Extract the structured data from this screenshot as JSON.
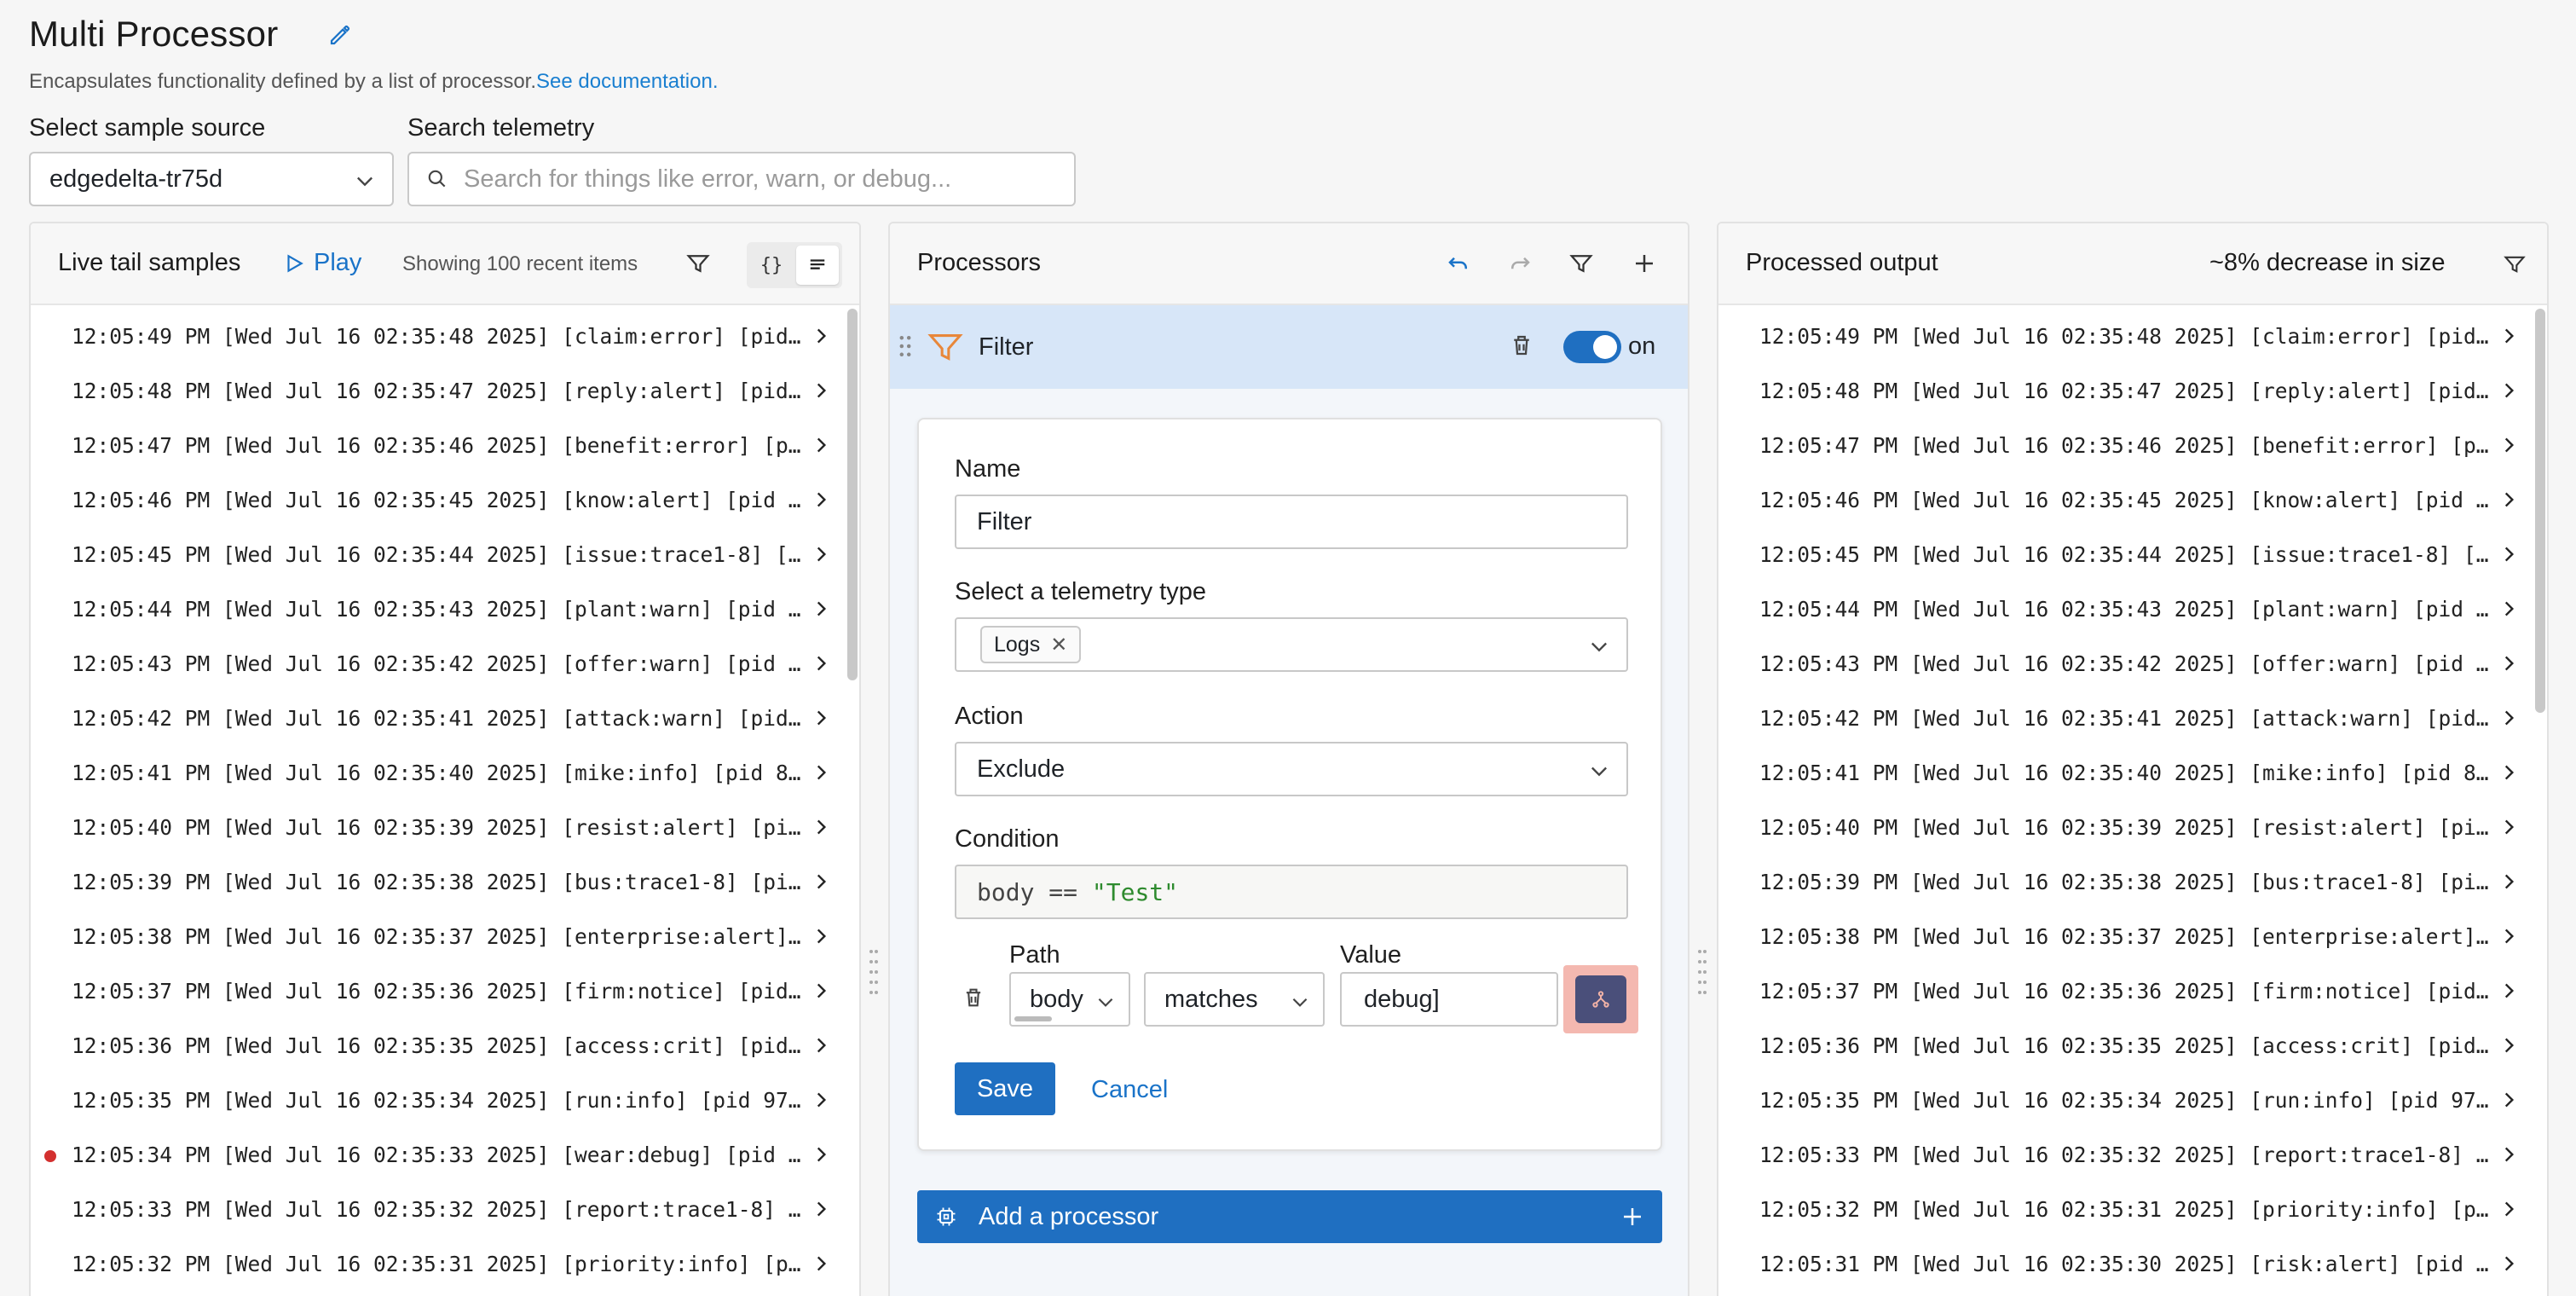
{
  "header": {
    "title": "Multi Processor",
    "subtitle": "Encapsulates functionality defined by a list of processor.",
    "doc_link": "See documentation."
  },
  "controls": {
    "source_label": "Select sample source",
    "source_value": "edgedelta-tr75d",
    "search_label": "Search telemetry",
    "search_placeholder": "Search for things like error, warn, or debug..."
  },
  "live_tail": {
    "title": "Live tail samples",
    "play_label": "Play",
    "showing": "Showing 100 recent items",
    "json_toggle": "{}",
    "rows": [
      "12:05:49 PM [Wed Jul 16 02:35:48 2025] [claim:error] [pid…",
      "12:05:48 PM [Wed Jul 16 02:35:47 2025] [reply:alert] [pid…",
      "12:05:47 PM [Wed Jul 16 02:35:46 2025] [benefit:error] [p…",
      "12:05:46 PM [Wed Jul 16 02:35:45 2025] [know:alert] [pid …",
      "12:05:45 PM [Wed Jul 16 02:35:44 2025] [issue:trace1-8] […",
      "12:05:44 PM [Wed Jul 16 02:35:43 2025] [plant:warn] [pid …",
      "12:05:43 PM [Wed Jul 16 02:35:42 2025] [offer:warn] [pid …",
      "12:05:42 PM [Wed Jul 16 02:35:41 2025] [attack:warn] [pid…",
      "12:05:41 PM [Wed Jul 16 02:35:40 2025] [mike:info] [pid 8…",
      "12:05:40 PM [Wed Jul 16 02:35:39 2025] [resist:alert] [pi…",
      "12:05:39 PM [Wed Jul 16 02:35:38 2025] [bus:trace1-8] [pi…",
      "12:05:38 PM [Wed Jul 16 02:35:37 2025] [enterprise:alert]…",
      "12:05:37 PM [Wed Jul 16 02:35:36 2025] [firm:notice] [pid…",
      "12:05:36 PM [Wed Jul 16 02:35:35 2025] [access:crit] [pid…",
      "12:05:35 PM [Wed Jul 16 02:35:34 2025] [run:info] [pid 97…",
      "12:05:34 PM [Wed Jul 16 02:35:33 2025] [wear:debug] [pid …",
      "12:05:33 PM [Wed Jul 16 02:35:32 2025] [report:trace1-8] …",
      "12:05:32 PM [Wed Jul 16 02:35:31 2025] [priority:info] [p…"
    ],
    "marked_row_index": 15
  },
  "processors": {
    "title": "Processors",
    "filter": {
      "name": "Filter",
      "toggle_label": "on",
      "form": {
        "name_label": "Name",
        "name_value": "Filter",
        "telemetry_label": "Select a telemetry type",
        "telemetry_chip": "Logs",
        "action_label": "Action",
        "action_value": "Exclude",
        "condition_label": "Condition",
        "condition_key": "body ==",
        "condition_str": "\"Test\"",
        "path_label": "Path",
        "path_value": "body",
        "operator_value": "matches",
        "value_label": "Value",
        "value_value": "debug]",
        "save_label": "Save",
        "cancel_label": "Cancel"
      }
    },
    "add_label": "Add a processor"
  },
  "output": {
    "title": "Processed output",
    "size_change": "~8% decrease in size",
    "rows": [
      "12:05:49 PM [Wed Jul 16 02:35:48 2025] [claim:error] [pid…",
      "12:05:48 PM [Wed Jul 16 02:35:47 2025] [reply:alert] [pid…",
      "12:05:47 PM [Wed Jul 16 02:35:46 2025] [benefit:error] [p…",
      "12:05:46 PM [Wed Jul 16 02:35:45 2025] [know:alert] [pid …",
      "12:05:45 PM [Wed Jul 16 02:35:44 2025] [issue:trace1-8] […",
      "12:05:44 PM [Wed Jul 16 02:35:43 2025] [plant:warn] [pid …",
      "12:05:43 PM [Wed Jul 16 02:35:42 2025] [offer:warn] [pid …",
      "12:05:42 PM [Wed Jul 16 02:35:41 2025] [attack:warn] [pid…",
      "12:05:41 PM [Wed Jul 16 02:35:40 2025] [mike:info] [pid 8…",
      "12:05:40 PM [Wed Jul 16 02:35:39 2025] [resist:alert] [pi…",
      "12:05:39 PM [Wed Jul 16 02:35:38 2025] [bus:trace1-8] [pi…",
      "12:05:38 PM [Wed Jul 16 02:35:37 2025] [enterprise:alert]…",
      "12:05:37 PM [Wed Jul 16 02:35:36 2025] [firm:notice] [pid…",
      "12:05:36 PM [Wed Jul 16 02:35:35 2025] [access:crit] [pid…",
      "12:05:35 PM [Wed Jul 16 02:35:34 2025] [run:info] [pid 97…",
      "12:05:33 PM [Wed Jul 16 02:35:32 2025] [report:trace1-8] …",
      "12:05:32 PM [Wed Jul 16 02:35:31 2025] [priority:info] [p…",
      "12:05:31 PM [Wed Jul 16 02:35:30 2025] [risk:alert] [pid …"
    ]
  },
  "colors": {
    "accent": "#1f6fc1",
    "selected_row": "#d7e6f8",
    "marker": "#d3302f",
    "highlight": "#f4b8b0",
    "ai_button": "#4a4f7a"
  }
}
